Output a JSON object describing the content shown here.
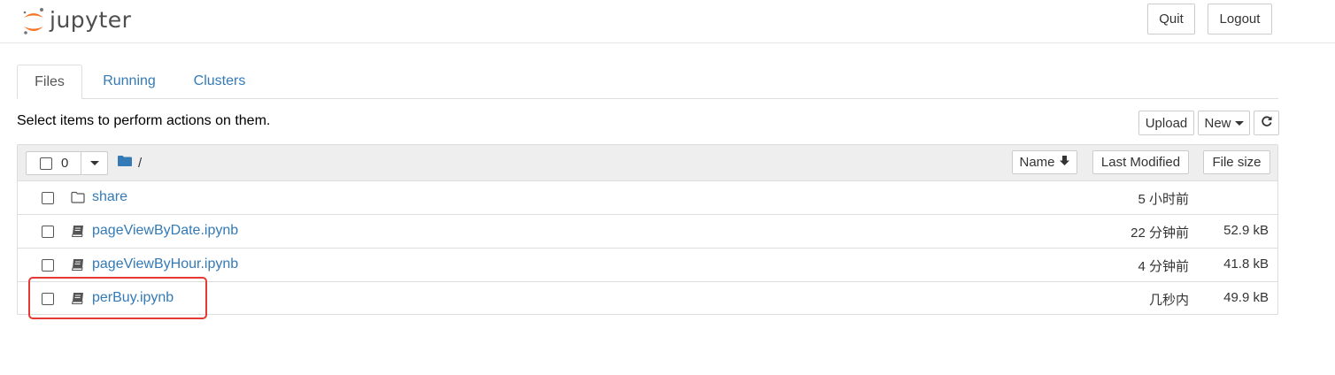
{
  "header": {
    "logo_text": "jupyter",
    "quit_label": "Quit",
    "logout_label": "Logout"
  },
  "tabs": [
    {
      "label": "Files",
      "active": true
    },
    {
      "label": "Running",
      "active": false
    },
    {
      "label": "Clusters",
      "active": false
    }
  ],
  "toolbar": {
    "instructions": "Select items to perform actions on them.",
    "upload_label": "Upload",
    "new_label": "New"
  },
  "list_header": {
    "selected_count": "0",
    "breadcrumb": "/",
    "sort_name_label": "Name",
    "sort_modified_label": "Last Modified",
    "sort_size_label": "File size"
  },
  "files": [
    {
      "name": "share",
      "type": "folder",
      "modified": "5 小时前",
      "size": ""
    },
    {
      "name": "pageViewByDate.ipynb",
      "type": "notebook",
      "modified": "22 分钟前",
      "size": "52.9 kB"
    },
    {
      "name": "pageViewByHour.ipynb",
      "type": "notebook",
      "modified": "4 分钟前",
      "size": "41.8 kB"
    },
    {
      "name": "perBuy.ipynb",
      "type": "notebook",
      "modified": "几秒内",
      "size": "49.9 kB"
    }
  ],
  "colors": {
    "link": "#337ab7",
    "logo_orange": "#f37726",
    "highlight": "#e53935"
  }
}
